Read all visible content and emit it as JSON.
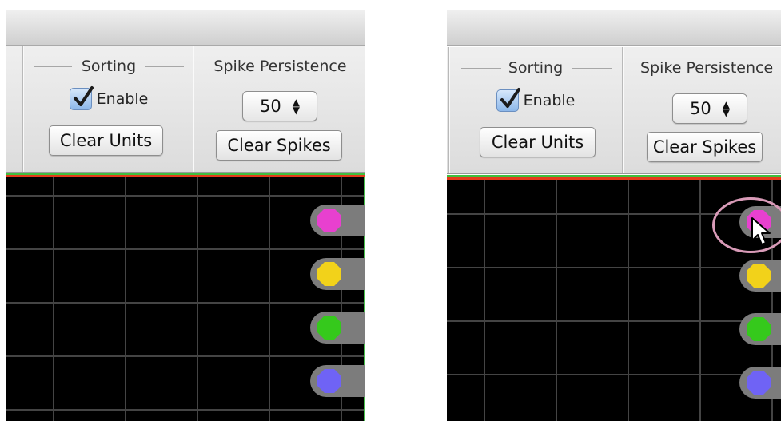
{
  "panels": [
    {
      "sorting": {
        "title": "Sorting",
        "enable_label": "Enable",
        "enable_checked": true,
        "clear_units_label": "Clear Units"
      },
      "spike_persistence": {
        "title": "Spike Persistence",
        "value": "50",
        "clear_spikes_label": "Clear Spikes"
      }
    },
    {
      "sorting": {
        "title": "Sorting",
        "enable_label": "Enable",
        "enable_checked": true,
        "clear_units_label": "Clear Units"
      },
      "spike_persistence": {
        "title": "Spike Persistence",
        "value": "50",
        "clear_spikes_label": "Clear Spikes"
      }
    }
  ],
  "unit_colors": [
    "#e840cf",
    "#f2d21a",
    "#35c91c",
    "#6f63f5"
  ],
  "colors": {
    "plot_background": "#000000",
    "threshold_line": "#e53b1a",
    "frame_edge": "#3fbf3f"
  }
}
